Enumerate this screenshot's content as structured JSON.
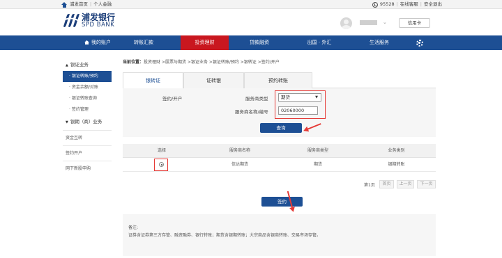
{
  "topbar": {
    "home_link": "浦发首页",
    "personal_finance_link": "个人金融",
    "phone": "95528",
    "online_service": "在线客服",
    "secure_logout": "安全退出"
  },
  "header": {
    "logo_cn": "浦发银行",
    "logo_en": "SPD BANK",
    "user_caret": "⌄",
    "card_button": "信用卡"
  },
  "nav": {
    "items": [
      {
        "label": "我的账户"
      },
      {
        "label": "转账汇款"
      },
      {
        "label": "投资理财"
      },
      {
        "label": "贷款融资"
      },
      {
        "label": "出国 · 外汇"
      },
      {
        "label": "生活服务"
      }
    ]
  },
  "sidebar": {
    "section1": "银证业务",
    "section1_items": [
      "· 银证转账/预约",
      "· 资金余额/对账",
      "· 银证转账查询",
      "· 签约管理"
    ],
    "section2": "银期（商）业务",
    "links": [
      "资金互转",
      "签约开户",
      "网下新股申购"
    ]
  },
  "breadcrumb": {
    "prefix": "当前位置：",
    "path": "投资理财 >股票与期货 >银证业务 >银证转账/预约 >银转证 >",
    "current": "签约/开户"
  },
  "tabs": [
    "银转证",
    "证转银",
    "预约转账"
  ],
  "form": {
    "section_label": "签约/开户",
    "type_label": "服务商类型",
    "type_value": "期货",
    "type_caret": "▼",
    "code_label": "服务商名称/编号",
    "code_value": "02060000",
    "query_button": "查询"
  },
  "table": {
    "headers": [
      "选择",
      "服务商名称",
      "服务商类型",
      "业务类别"
    ],
    "rows": [
      {
        "name": "信达期货",
        "type": "期货",
        "category": "银期转账"
      }
    ]
  },
  "pager": {
    "page_info": "第1页",
    "first": "首页",
    "prev": "上一页",
    "next": "下一页"
  },
  "sign_button": "签约",
  "notes": {
    "title": "备注:",
    "text": "证券含证券第三方存管、融资融券、银行转账；期货含银期转账；大宗商品含银商转账、交易市场存管。"
  }
}
